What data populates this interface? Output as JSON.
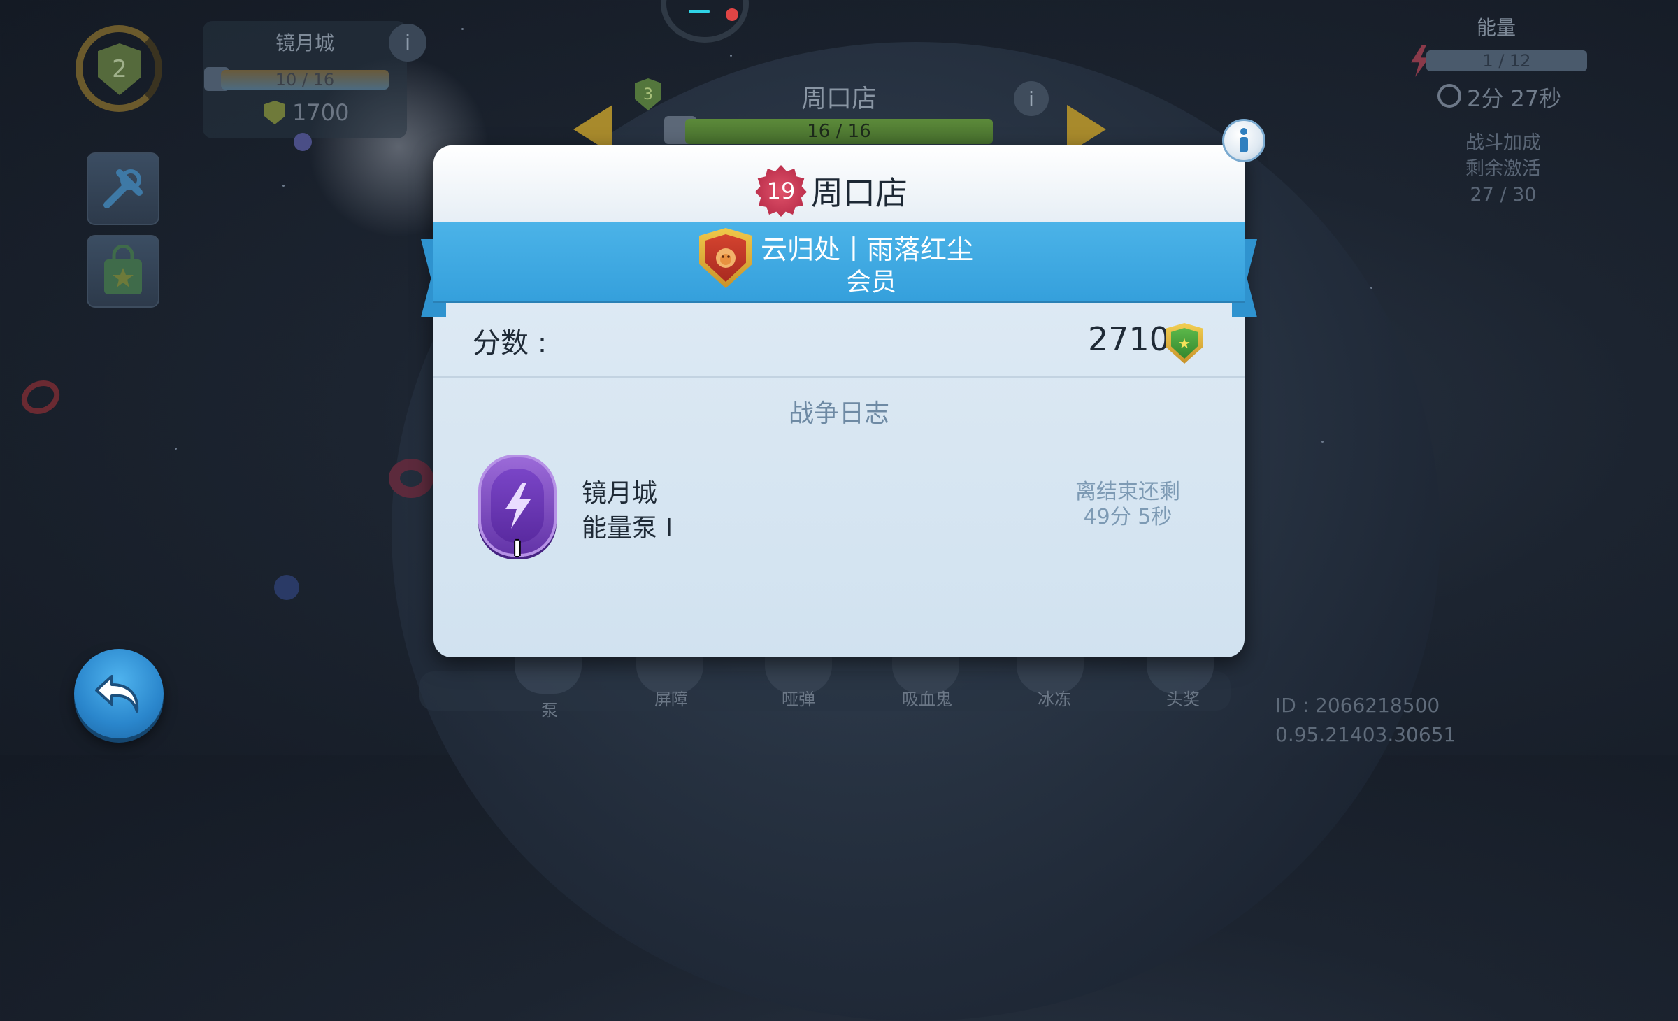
{
  "hud_left": {
    "level": "2",
    "city_name": "镜月城",
    "city_progress": "10 / 16",
    "city_score": "1700"
  },
  "hud_center_bg": {
    "badge": "3",
    "title": "周口店",
    "progress": "16 / 16"
  },
  "hud_right": {
    "energy_label": "能量",
    "energy_value": "1 / 12",
    "timer": "2分 27秒",
    "boost_line1": "战斗加成",
    "boost_line2": "剩余激活",
    "boost_line3": "27 / 30"
  },
  "skills": [
    "泵",
    "屏障",
    "哑弹",
    "吸血鬼",
    "冰冻",
    "头奖"
  ],
  "build_info": {
    "id_line": "ID : 2066218500",
    "version_line": "0.95.21403.30651"
  },
  "dialog": {
    "level": "19",
    "title": "周口店",
    "clan_name": "云归处丨雨落红尘",
    "clan_role": "会员",
    "score_label": "分数 :",
    "score_value": "2710",
    "log_title": "战争日志",
    "log_entry": {
      "city": "镜月城",
      "building": "能量泵",
      "tier": "I",
      "remaining_line1": "离结束还剩",
      "remaining_line2": "49分 5秒"
    }
  },
  "colors": {
    "ribbon": "#3fa9e2",
    "level_badge": "#c8344f",
    "pump_purple": "#7a45c7",
    "back_button": "#2a86cc"
  }
}
